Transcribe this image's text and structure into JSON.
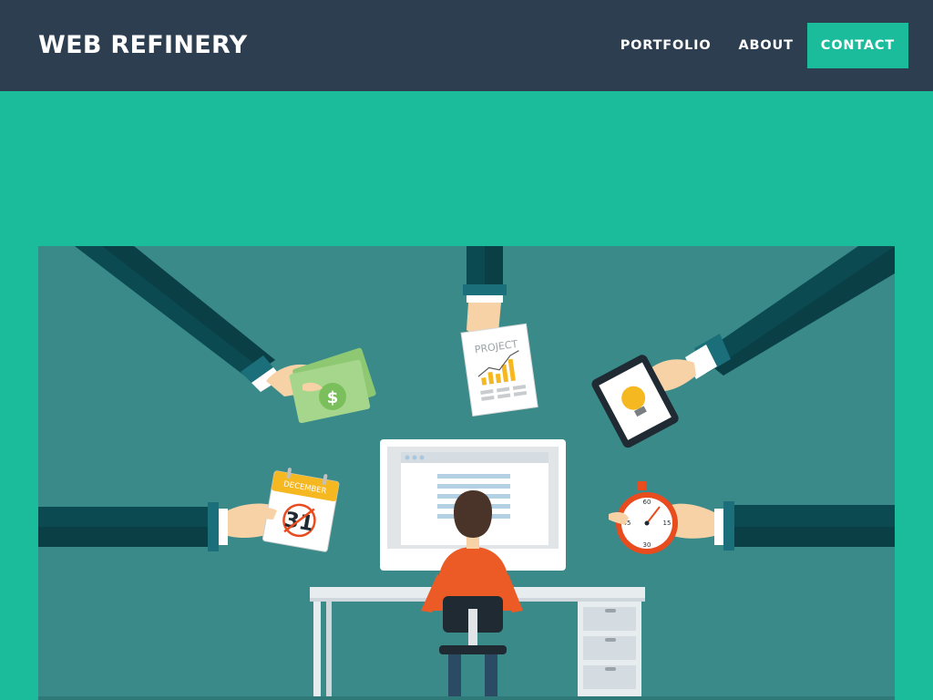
{
  "brand": {
    "name": "WEB REFINERY"
  },
  "nav": [
    {
      "label": "PORTFOLIO"
    },
    {
      "label": "ABOUT"
    },
    {
      "label": "CONTACT",
      "active": true
    }
  ],
  "hero": {
    "document_label": "PROJECT",
    "calendar_month": "DECEMBER",
    "calendar_day": "31",
    "timer_marks": [
      "60",
      "15",
      "30",
      "45"
    ]
  },
  "colors": {
    "header_bg": "#2c3e50",
    "accent": "#1abc9c",
    "illustration_bg": "#3a8a8a",
    "sleeve": "#0c4a52",
    "cuff": "#1a6f7a",
    "skin": "#f6d2a6",
    "shirt": "#ec5b26",
    "money": "#a6d68b",
    "calendar_top": "#f6b820",
    "stopwatch": "#e84c1e"
  },
  "icons": [
    "dollar-icon",
    "lightbulb-icon",
    "bar-chart-icon",
    "stopwatch-icon",
    "calendar-icon"
  ]
}
